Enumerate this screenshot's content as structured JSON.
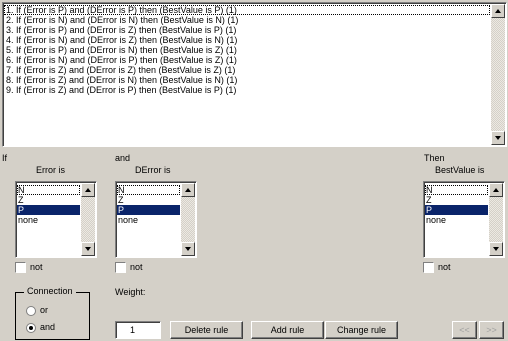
{
  "rules": [
    "1. If (Error is P) and (DError is P) then (BestValue is P) (1)",
    "2. If (Error is N) and (DError is N) then (BestValue is N) (1)",
    "3. If (Error is P) and (DError is Z) then (BestValue is P) (1)",
    "4. If (Error is N) and (DError is Z) then (BestValue is N) (1)",
    "5. If (Error is P) and (DError is N) then (BestValue is Z) (1)",
    "6. If (Error is N) and (DError is P) then (BestValue is Z) (1)",
    "7. If (Error is Z) and (DError is Z) then (BestValue is Z) (1)",
    "8. If (Error is Z) and (DError is N) then (BestValue is N) (1)",
    "9. If (Error is Z) and (DError is P) then (BestValue is P) (1)"
  ],
  "labels": {
    "if": "If",
    "and": "and",
    "then": "Then",
    "error_is": "Error is",
    "derror_is": "DError is",
    "bestvalue_is": "BestValue is",
    "not": "not",
    "connection": "Connection",
    "or": "or",
    "and_radio": "and",
    "weight": "Weight:"
  },
  "error_options": [
    "N",
    "Z",
    "P",
    "none"
  ],
  "derror_options": [
    "N",
    "Z",
    "P",
    "none"
  ],
  "bestvalue_options": [
    "N",
    "Z",
    "P",
    "none"
  ],
  "selected_option": "P",
  "connection_selected": "and",
  "weight_value": "1",
  "buttons": {
    "delete": "Delete rule",
    "add": "Add rule",
    "change": "Change rule",
    "prev": "<<",
    "next": ">>"
  }
}
